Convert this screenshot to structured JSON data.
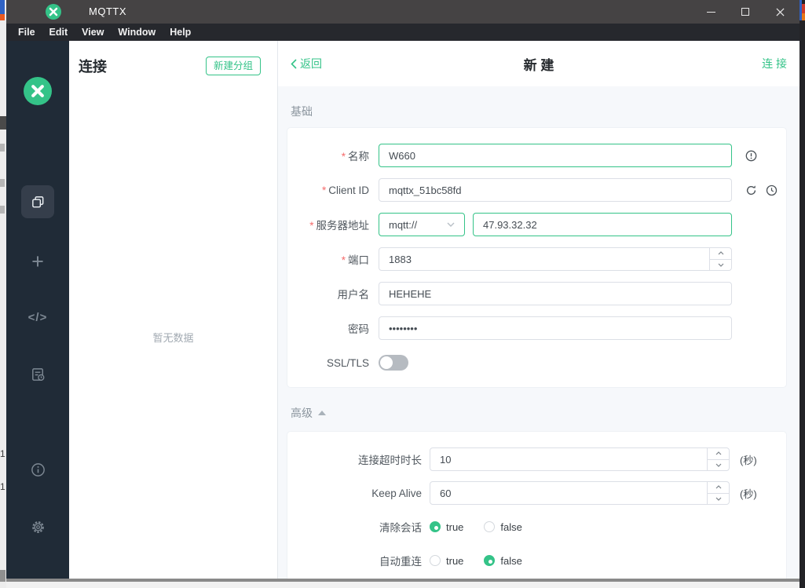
{
  "desktop": {
    "left_fragment_numbers": [
      "1",
      "1"
    ]
  },
  "window": {
    "title": "MQTTX",
    "menu": [
      "File",
      "Edit",
      "View",
      "Window",
      "Help"
    ]
  },
  "sidebar": {
    "plus_glyph": "+",
    "code_glyph": "</>",
    "icon_names": [
      "mqttx-logo",
      "connections",
      "new-connection",
      "script",
      "log",
      "about",
      "settings"
    ]
  },
  "connections_panel": {
    "title": "连接",
    "new_group_button": "新建分组",
    "empty_text": "暂无数据"
  },
  "main": {
    "back": "返回",
    "title": "新 建",
    "connect": "连 接",
    "required_mark": "*",
    "basic": {
      "title": "基础",
      "name_label": "名称",
      "name_value": "W660",
      "client_id_label": "Client ID",
      "client_id_value": "mqttx_51bc58fd",
      "host_label": "服务器地址",
      "protocol_value": "mqtt://",
      "host_value": "47.93.32.32",
      "port_label": "端口",
      "port_value": "1883",
      "username_label": "用户名",
      "username_value": "HEHEHE",
      "password_label": "密码",
      "password_value": "••••••••",
      "ssl_label": "SSL/TLS",
      "ssl_state": "off"
    },
    "advanced": {
      "title": "高级",
      "timeout_label": "连接超时时长",
      "timeout_value": "10",
      "timeout_suffix": "(秒)",
      "keepalive_label": "Keep Alive",
      "keepalive_value": "60",
      "keepalive_suffix": "(秒)",
      "clean_session_label": "清除会话",
      "clean_session_options": [
        "true",
        "false"
      ],
      "clean_session_selected": "true",
      "auto_reconnect_label": "自动重连",
      "auto_reconnect_options": [
        "true",
        "false"
      ],
      "auto_reconnect_selected": "false"
    }
  },
  "colors": {
    "accent_green": "#34c388",
    "danger_red": "#f56c6c",
    "titlebar": "#454344",
    "menubar": "#26282d",
    "sidebar": "#202b37",
    "content_bg": "#f6f8fb",
    "input_border": "#dcdfe6"
  }
}
